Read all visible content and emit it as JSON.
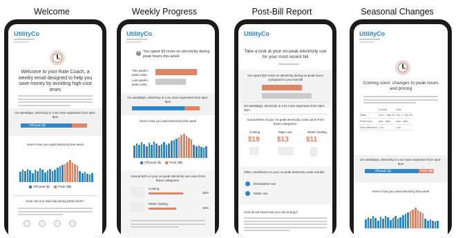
{
  "columns": [
    {
      "title": "Welcome"
    },
    {
      "title": "Weekly Progress"
    },
    {
      "title": "Post-Bill Report"
    },
    {
      "title": "Seasonal Changes"
    }
  ],
  "brand": "UtilityCo",
  "colors": {
    "blue": "#2d86c8",
    "peak": "#e08466",
    "bezel": "#1b1b1b"
  },
  "welcome": {
    "headline": "Welcome to your Rate Coach, a weekly email designed to help you save money by avoiding high-cost times",
    "weekday_note": "On weekdays, electricity is 1.5x more expensive from 4pm-9pm",
    "offpeak_label": "Off-peak ($)",
    "peak_label": "Peak ($$)",
    "how_used": "Here's how you used electricity this week",
    "legend_off": "Off-peak ($)",
    "legend_peak": "Peak ($$)",
    "big_savings": "How can you save big during peak hours?"
  },
  "weekly": {
    "spent_line": "You spent $3 more on electricity during peak hours this week",
    "row1": "This week's peak costs",
    "row2": "Last week's peak costs",
    "weekday_note": "On weekdays, electricity is 1.5x more expensive from 4pm-9pm",
    "how_used": "Here's how you used electricity this week",
    "legend_off": "Off-peak ($)",
    "legend_peak": "Peak ($$)",
    "categories_title": "Around 84% of your on-peak electricity use came from these categories:",
    "cat1": "Cooling",
    "cat2": "Water heating",
    "cat1_pct": "38%",
    "cat2_pct": "30%"
  },
  "postbill": {
    "headline": "Take a look at your on-peak electricity use for your most recent bill",
    "spent_line": "You spent $15 more on electricity during on-peak hours compared to your last bill",
    "weekday_note": "On weekdays, electricity is 1.5x more expensive from 4pm-9pm",
    "categories_title": "Around 84% of your on-peak electricity costs came from these categories:",
    "cat1": "Cooling",
    "cat2": "Major use",
    "cat3": "Water heating",
    "price1": "$19",
    "price2": "$13",
    "price3": "$11",
    "other_title": "Other contributors to your on-peak electricity costs include:",
    "other1": "Dishwasher use",
    "other2": "Water use",
    "how_save": "How do we know how you use energy?"
  },
  "seasonal": {
    "headline": "Coming soon: changes to peak hours and pricing",
    "table_head": [
      "",
      "Current",
      "New"
    ],
    "table_rows": [
      [
        "Dates",
        "Jun 1 - Sep 30",
        "Jun 1 - Sep 30"
      ],
      [
        "Peak hours",
        "4pm - 9pm",
        "3pm - 8pm"
      ],
      [
        "Price difference",
        "1.5x",
        "1.8x"
      ]
    ],
    "weekday_note": "On weekdays, electricity is 1.5x more expensive from 4pm-9pm",
    "offpeak_label": "Off-peak ($)",
    "peak_label": "Peak ($$)",
    "how_used": "Here's how you used electricity this week"
  }
}
